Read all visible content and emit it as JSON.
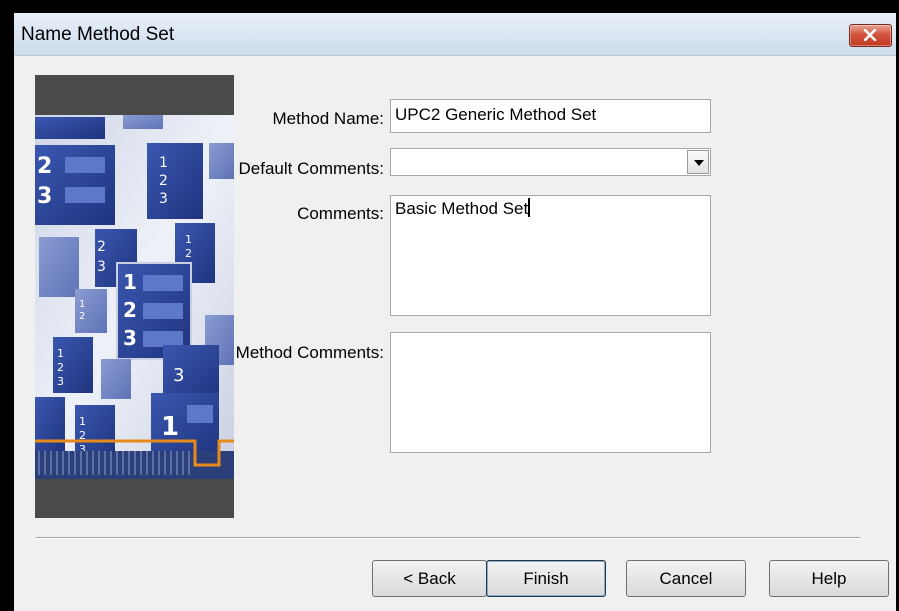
{
  "dialog": {
    "title": "Name Method Set"
  },
  "form": {
    "method_name_label": "Method Name:",
    "method_name_value": "UPC2 Generic Method Set",
    "default_comments_label": "Default Comments:",
    "default_comments_value": "",
    "comments_label": "Comments:",
    "comments_value": "Basic Method Set",
    "method_comments_label": "Method Comments:",
    "method_comments_value": ""
  },
  "buttons": {
    "back": "< Back",
    "finish": "Finish",
    "cancel": "Cancel",
    "help": "Help"
  },
  "icons": {
    "close": "close-icon",
    "dropdown": "chevron-down-icon",
    "banner": "method-set-banner-image"
  },
  "colors": {
    "titlebar": "#dbe6f2",
    "close_button": "#c94a30",
    "dialog_bg": "#f0f0f0",
    "banner_doc": "#2e4a9e",
    "banner_accent": "#e88a1a"
  }
}
